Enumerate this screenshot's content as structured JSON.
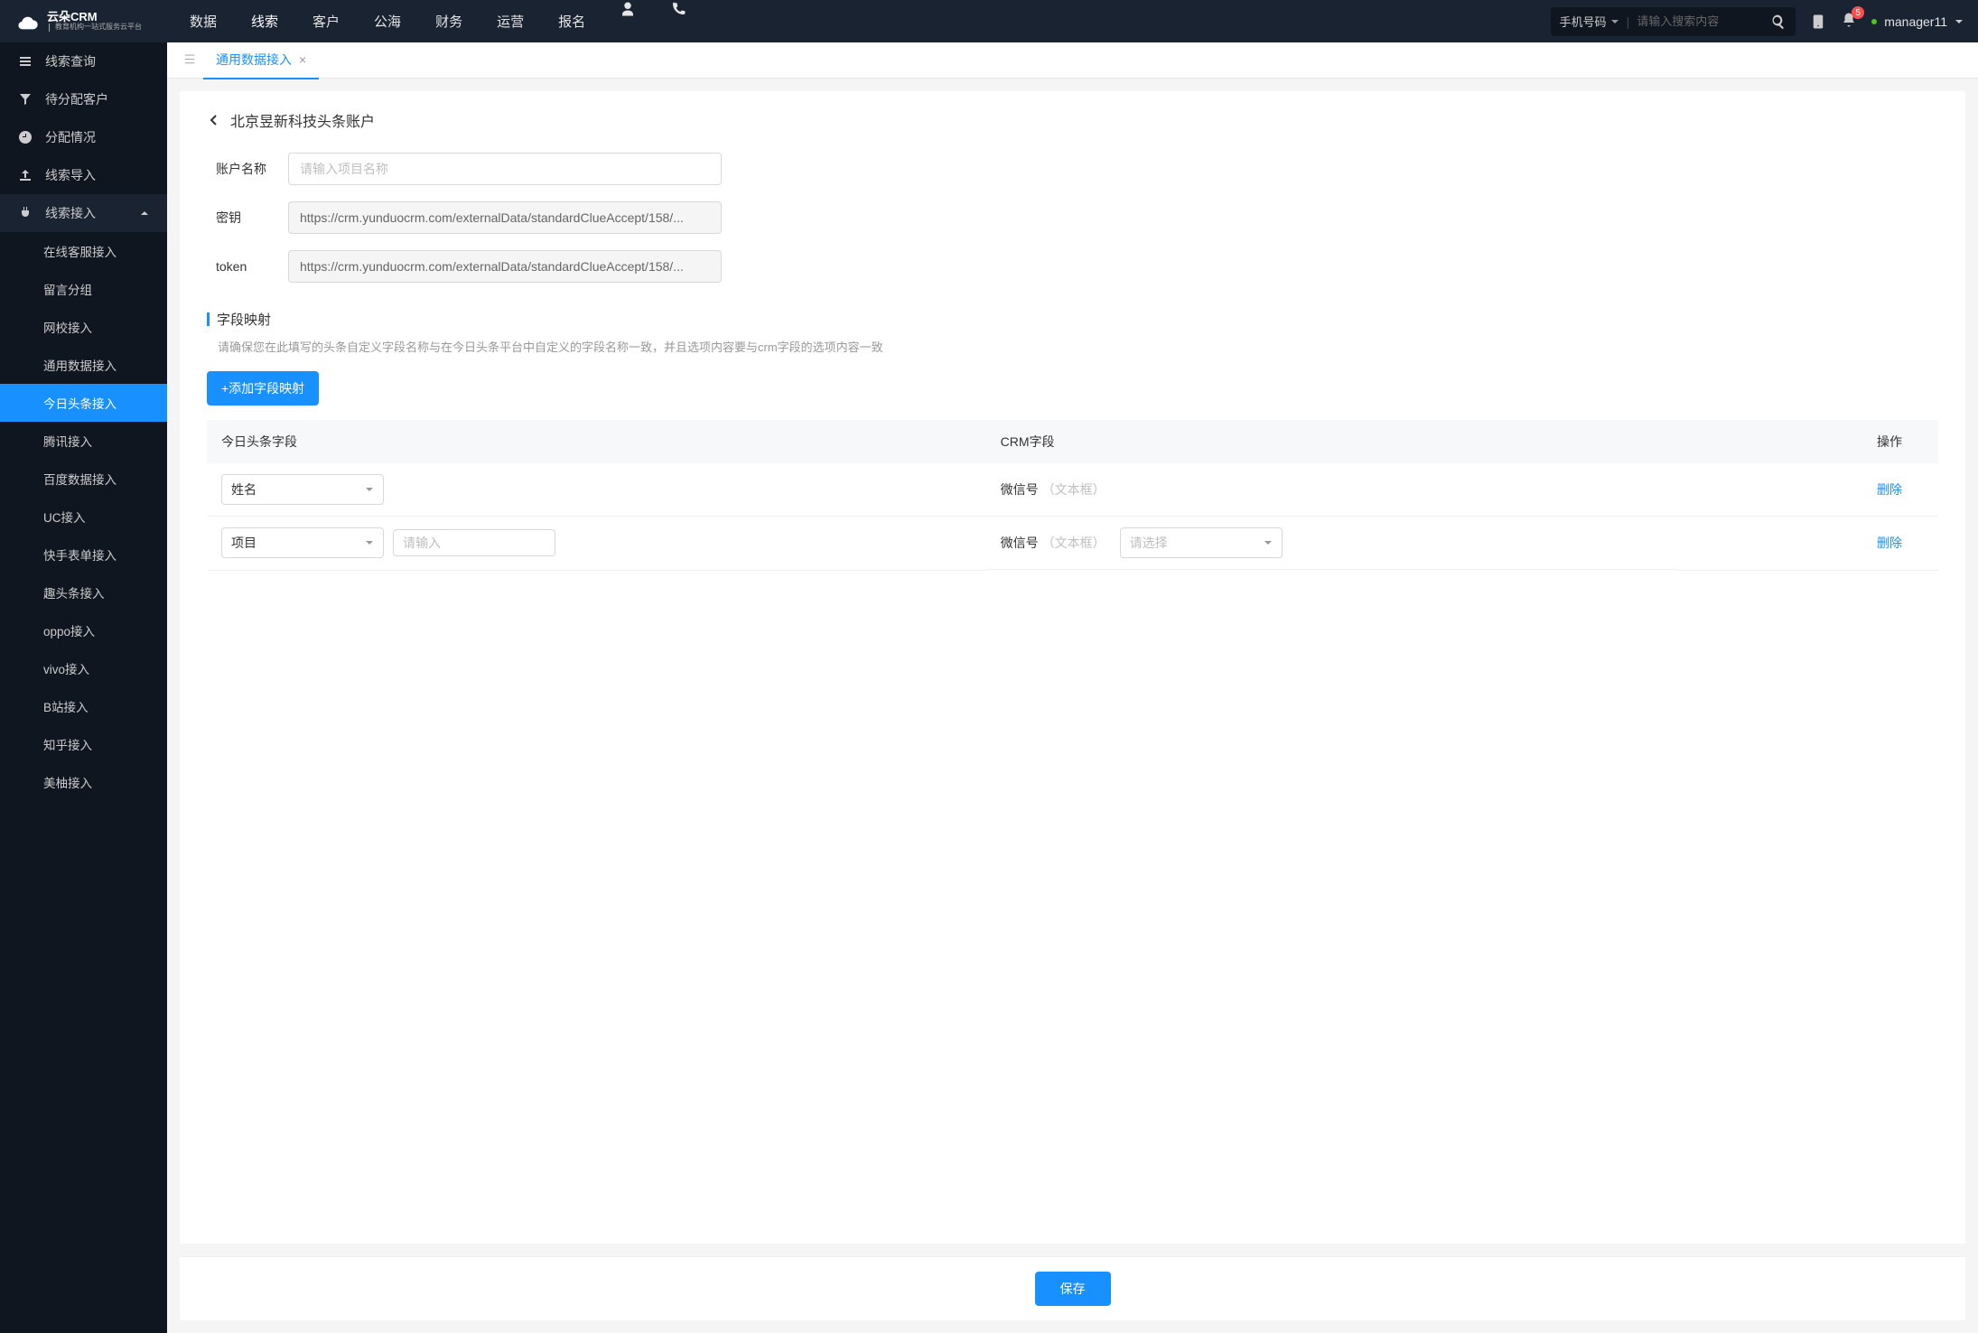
{
  "header": {
    "brand": "云朵CRM",
    "brand_sub": "教育机构一站式服务云平台",
    "nav": [
      "数据",
      "线索",
      "客户",
      "公海",
      "财务",
      "运营",
      "报名"
    ],
    "search_type": "手机号码",
    "search_placeholder": "请输入搜索内容",
    "notif_count": "5",
    "user": "manager11"
  },
  "sidebar": {
    "items": [
      {
        "label": "线索查询",
        "icon": "list"
      },
      {
        "label": "待分配客户",
        "icon": "filter"
      },
      {
        "label": "分配情况",
        "icon": "clock"
      },
      {
        "label": "线索导入",
        "icon": "upload"
      },
      {
        "label": "线索接入",
        "icon": "plug",
        "expanded": true
      }
    ],
    "sub_items": [
      "在线客服接入",
      "留言分组",
      "网校接入",
      "通用数据接入",
      "今日头条接入",
      "腾讯接入",
      "百度数据接入",
      "UC接入",
      "快手表单接入",
      "趣头条接入",
      "oppo接入",
      "vivo接入",
      "B站接入",
      "知乎接入",
      "美柚接入"
    ],
    "active_sub": "今日头条接入"
  },
  "tabs": {
    "current": "通用数据接入"
  },
  "page": {
    "title": "北京昱新科技头条账户",
    "form": {
      "name_label": "账户名称",
      "name_placeholder": "请输入项目名称",
      "key_label": "密钥",
      "key_value": "https://crm.yunduocrm.com/externalData/standardClueAccept/158/...",
      "token_label": "token",
      "token_value": "https://crm.yunduocrm.com/externalData/standardClueAccept/158/..."
    },
    "section": {
      "title": "字段映射",
      "desc": "请确保您在此填写的头条自定义字段名称与在今日头条平台中自定义的字段名称一致，并且选项内容要与crm字段的选项内容一致",
      "add_btn": "+添加字段映射"
    },
    "table": {
      "headers": [
        "今日头条字段",
        "CRM字段",
        "操作"
      ],
      "rows": [
        {
          "toutiao_value": "姓名",
          "toutiao_extra_input": false,
          "crm_name": "微信号",
          "crm_type": "（文本框）",
          "crm_select": false,
          "action": "删除"
        },
        {
          "toutiao_value": "项目",
          "toutiao_extra_input": true,
          "extra_placeholder": "请输入",
          "crm_name": "微信号",
          "crm_type": "（文本框）",
          "crm_select": true,
          "crm_select_placeholder": "请选择",
          "action": "删除"
        }
      ]
    },
    "save_btn": "保存"
  }
}
